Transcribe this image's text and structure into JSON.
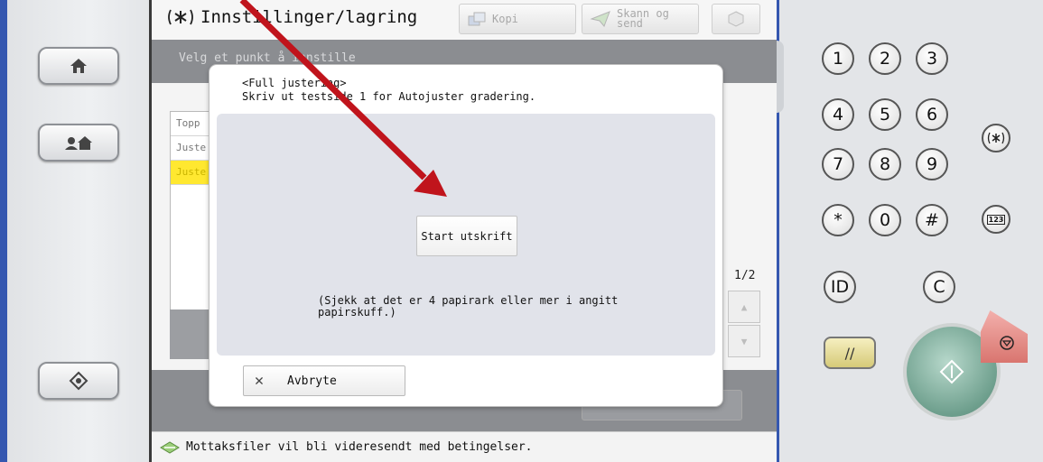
{
  "header": {
    "title": "Innstillinger/lagring",
    "tab_copy": "Kopi",
    "tab_scan_line1": "Skann og",
    "tab_scan_line2": "send"
  },
  "subtitle": "Velg et punkt å innstille",
  "background_list": [
    "Topp",
    "Juste",
    "Juste"
  ],
  "dialog": {
    "heading_line1": "<Full justering>",
    "heading_line2": "Skriv ut testside 1 for Autojuster gradering.",
    "start_button": "Start utskrift",
    "note_line1": "(Sjekk at det er 4 papirark eller mer i angitt",
    "note_line2": "papirskuff.)",
    "cancel_button": "Avbryte"
  },
  "page_indicator": "1/2",
  "status_message": "Mottaksfiler vil bli videresendt med betingelser.",
  "keypad": {
    "keys": [
      "1",
      "2",
      "3",
      "4",
      "5",
      "6",
      "7",
      "8",
      "9",
      "*",
      "0",
      "#"
    ],
    "id_key": "ID",
    "clear_key": "C",
    "counter_key": "123"
  },
  "colors": {
    "annotation_arrow": "#c0141c",
    "highlight_row": "#ffe830",
    "panel_border": "#3557b0"
  }
}
